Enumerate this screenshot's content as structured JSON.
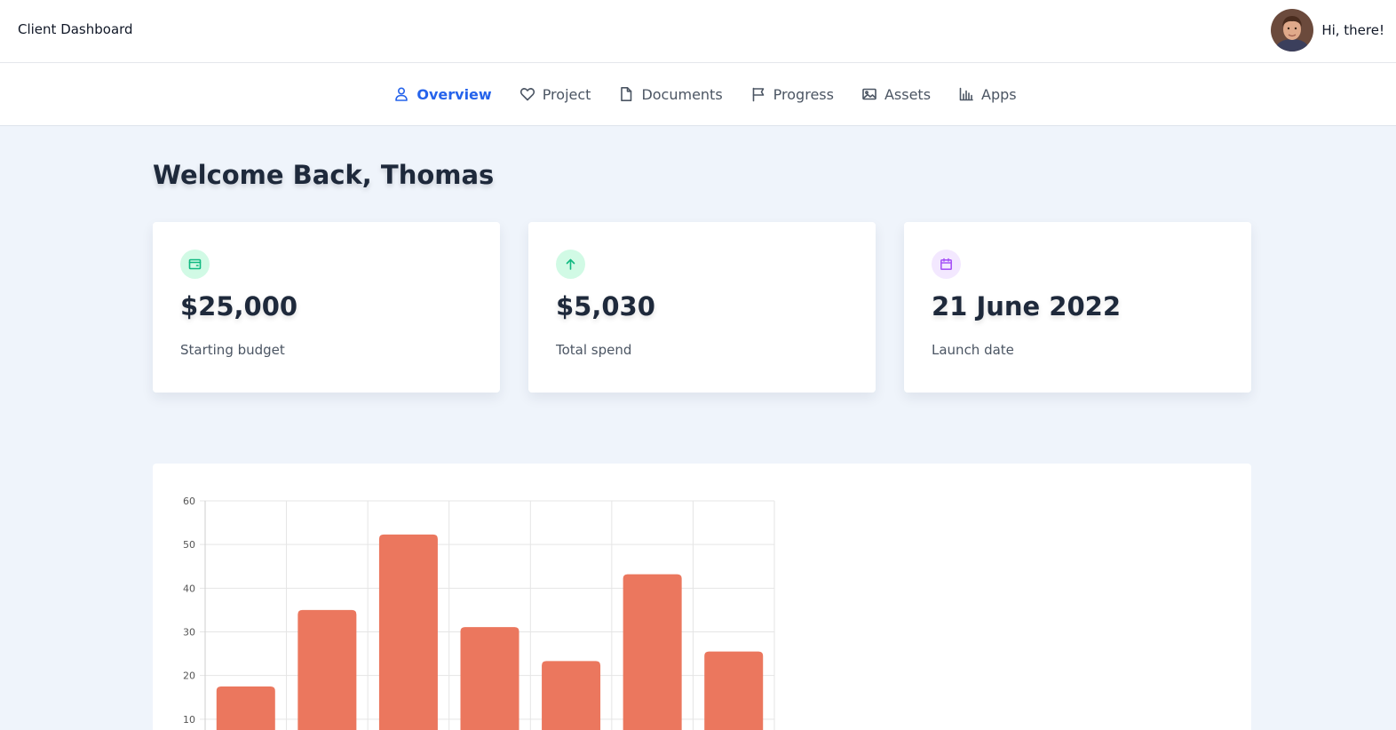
{
  "header": {
    "title": "Client Dashboard",
    "greeting": "Hi, there!"
  },
  "nav": {
    "items": [
      {
        "label": "Overview",
        "icon": "user-icon",
        "active": true
      },
      {
        "label": "Project",
        "icon": "heart-icon",
        "active": false
      },
      {
        "label": "Documents",
        "icon": "document-icon",
        "active": false
      },
      {
        "label": "Progress",
        "icon": "flag-icon",
        "active": false
      },
      {
        "label": "Assets",
        "icon": "image-icon",
        "active": false
      },
      {
        "label": "Apps",
        "icon": "bar-chart-icon",
        "active": false
      }
    ]
  },
  "main": {
    "welcome": "Welcome Back, Thomas",
    "cards": [
      {
        "value": "$25,000",
        "label": "Starting budget",
        "icon": "wallet-icon",
        "icon_color": "#10b981",
        "badge_color": "#d1fae5"
      },
      {
        "value": "$5,030",
        "label": "Total spend",
        "icon": "arrow-up-icon",
        "icon_color": "#10b981",
        "badge_color": "#d1fae5"
      },
      {
        "value": "21 June 2022",
        "label": "Launch date",
        "icon": "calendar-icon",
        "icon_color": "#a855f7",
        "badge_color": "#f3e8ff"
      }
    ]
  },
  "colors": {
    "accent": "#2563eb",
    "bar": "#eb775e",
    "background": "#eff4fb"
  },
  "chart_data": {
    "type": "bar",
    "categories": [
      "",
      "",
      "",
      "",
      "",
      "",
      ""
    ],
    "values": [
      17.5,
      35,
      52.3,
      31.1,
      23.3,
      43.2,
      25.5
    ],
    "yticks": [
      10,
      20,
      30,
      40,
      50,
      60
    ],
    "ylim": [
      0,
      60
    ],
    "grid": true,
    "legend": "none"
  }
}
